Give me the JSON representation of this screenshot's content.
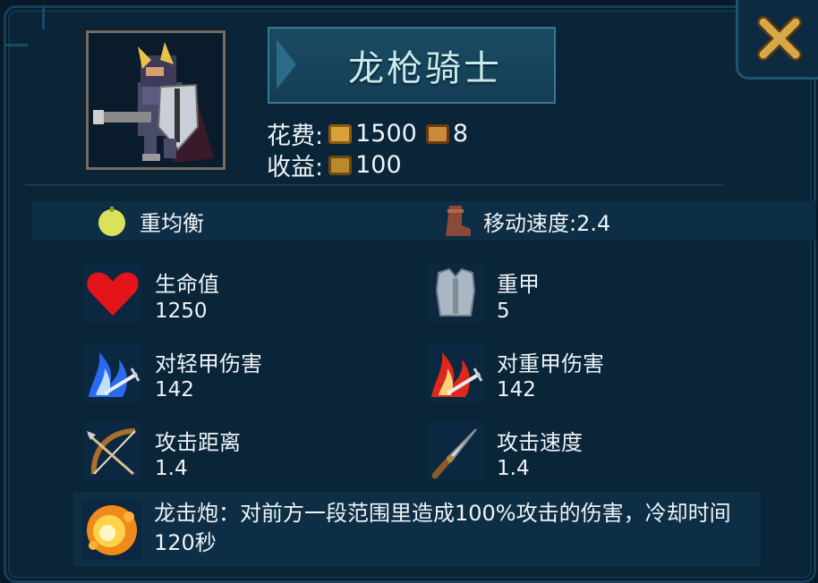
{
  "unit": {
    "name": "龙枪骑士",
    "cost_label": "花费:",
    "cost_gold": "1500",
    "cost_pop": "8",
    "income_label": "收益:",
    "income": "100"
  },
  "traits": {
    "weight": "重均衡",
    "move_speed": "移动速度:2.4"
  },
  "stats": [
    {
      "label": "生命值",
      "value": "1250"
    },
    {
      "label": "重甲",
      "value": "5"
    },
    {
      "label": "对轻甲伤害",
      "value": "142"
    },
    {
      "label": "对重甲伤害",
      "value": "142"
    },
    {
      "label": "攻击距离",
      "value": "1.4"
    },
    {
      "label": "攻击速度",
      "value": "1.4"
    }
  ],
  "skill": {
    "description": "龙击炮：对前方一段范围里造成100%攻击的伤害，冷却时间120秒"
  },
  "icons": {
    "close": "close-icon",
    "gold": "gold-coin-icon",
    "pop": "population-icon",
    "income": "income-chest-icon",
    "weight": "lemon-weight-icon",
    "boot": "boot-icon",
    "heart": "heart-icon",
    "armor": "armor-icon",
    "light_damage": "blue-sword-icon",
    "heavy_damage": "red-sword-icon",
    "range": "bow-icon",
    "attack_speed": "dagger-icon",
    "skill": "explosion-icon"
  },
  "colors": {
    "background": "#0a2438",
    "accent": "#c6ecec",
    "close": "#c89a3a"
  }
}
